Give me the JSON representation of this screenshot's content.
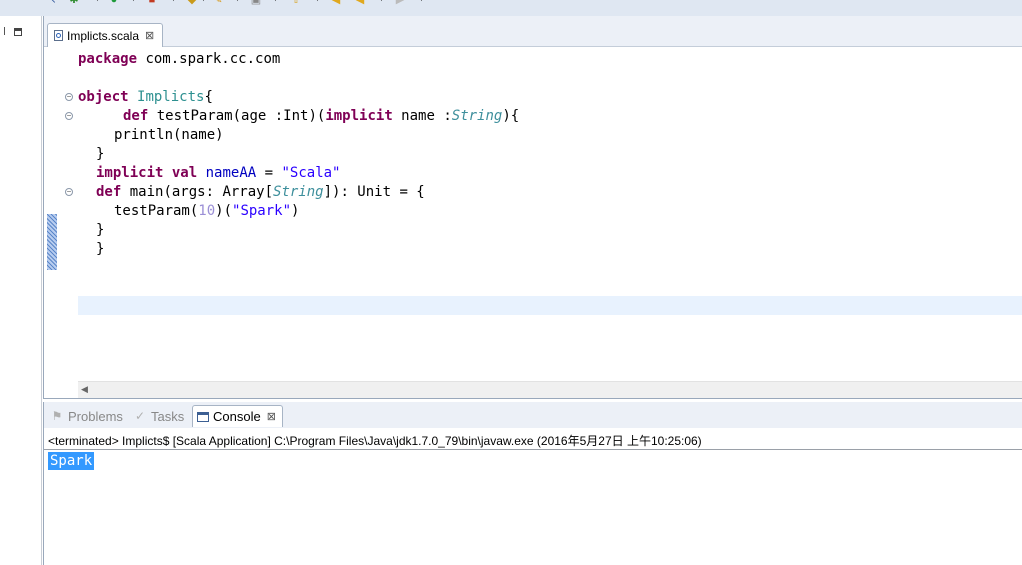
{
  "editor": {
    "tab_label": "Implicts.scala",
    "tab_close": "⊠",
    "code": {
      "l1_kw": "package",
      "l1_rest": " com.spark.cc.com",
      "l3_kw": "object",
      "l3_name": "Implicts",
      "l3_brace": "{",
      "l4_def": "def",
      "l4_a": " testParam(age :Int)(",
      "l4_impl": "implicit",
      "l4_b": " name :",
      "l4_type": "String",
      "l4_c": "){",
      "l5": "println(name)",
      "l6": "}",
      "l7_impl": "implicit",
      "l7_val": "val",
      "l7_name": "nameAA",
      "l7_eq": " = ",
      "l7_str": "\"Scala\"",
      "l8_def": "def",
      "l8_a": " main(args: Array[",
      "l8_type": "String",
      "l8_b": "]): Unit = {",
      "l9_a": "testParam(",
      "l9_num": "10",
      "l9_b": ")(",
      "l9_str": "\"Spark\"",
      "l9_c": ")",
      "l10": "}",
      "l11": "}"
    }
  },
  "console": {
    "tabs": [
      {
        "label": "Problems",
        "icon": "problems-icon"
      },
      {
        "label": "Tasks",
        "icon": "tasks-icon"
      },
      {
        "label": "Console",
        "icon": "console-icon"
      }
    ],
    "close": "⊠",
    "status": "<terminated> Implicts$ [Scala Application] C:\\Program Files\\Java\\jdk1.7.0_79\\bin\\javaw.exe (2016年5月27日 上午10:25:06)",
    "output": "Spark"
  }
}
